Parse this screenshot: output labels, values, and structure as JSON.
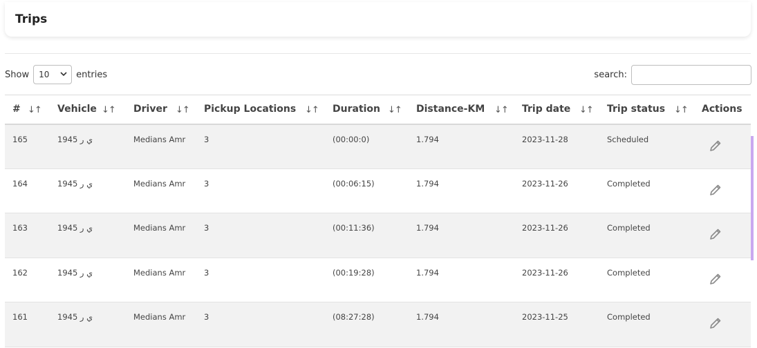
{
  "page": {
    "title": "Trips"
  },
  "controls": {
    "show_label": "Show",
    "entries_value": "10",
    "entries_label": "entries",
    "search_label": "search:",
    "search_value": ""
  },
  "table": {
    "columns": [
      {
        "label": "#",
        "sort_icon": "↓↑"
      },
      {
        "label": "Vehicle",
        "sort_icon": "↓↑"
      },
      {
        "label": "Driver",
        "sort_icon": "↓↑"
      },
      {
        "label": "Pickup Locations",
        "sort_icon": "↓↑"
      },
      {
        "label": "Duration",
        "sort_icon": "↓↑"
      },
      {
        "label": "Distance-KM",
        "sort_icon": "↓↑"
      },
      {
        "label": "Trip date",
        "sort_icon": "↓↑"
      },
      {
        "label": "Trip status",
        "sort_icon": "↓↑"
      },
      {
        "label": "Actions"
      }
    ],
    "rows": [
      {
        "id": "165",
        "vehicle": "ي ر 1945",
        "driver": "Medians Amr",
        "pickup": "3",
        "duration": "(00:00:0)",
        "distance": "1.794",
        "date": "2023-11-28",
        "status": "Scheduled",
        "action_icon": "pencil-icon"
      },
      {
        "id": "164",
        "vehicle": "ي ر 1945",
        "driver": "Medians Amr",
        "pickup": "3",
        "duration": "(00:06:15)",
        "distance": "1.794",
        "date": "2023-11-26",
        "status": "Completed",
        "action_icon": "pencil-icon"
      },
      {
        "id": "163",
        "vehicle": "ي ر 1945",
        "driver": "Medians Amr",
        "pickup": "3",
        "duration": "(00:11:36)",
        "distance": "1.794",
        "date": "2023-11-26",
        "status": "Completed",
        "action_icon": "pencil-icon"
      },
      {
        "id": "162",
        "vehicle": "ي ر 1945",
        "driver": "Medians Amr",
        "pickup": "3",
        "duration": "(00:19:28)",
        "distance": "1.794",
        "date": "2023-11-26",
        "status": "Completed",
        "action_icon": "pencil-icon"
      },
      {
        "id": "161",
        "vehicle": "ي ر 1945",
        "driver": "Medians Amr",
        "pickup": "3",
        "duration": "(08:27:28)",
        "distance": "1.794",
        "date": "2023-11-25",
        "status": "Completed",
        "action_icon": "pencil-icon"
      }
    ]
  },
  "colors": {
    "row_stripe": "#f2f2f2",
    "scroll_accent": "#c9a8f0",
    "icon": "#8a8a8a"
  }
}
